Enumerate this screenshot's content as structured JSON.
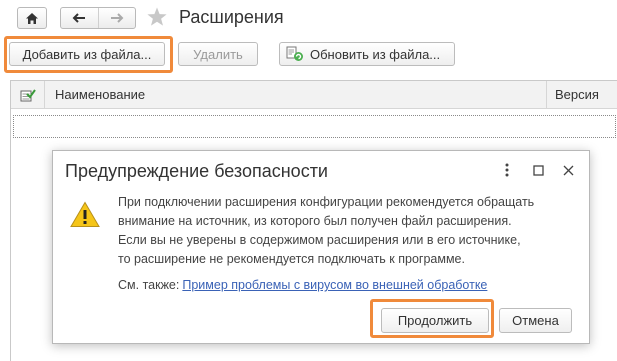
{
  "window": {
    "title": "Расширения"
  },
  "toolbar": {
    "add_label": "Добавить из файла...",
    "delete_label": "Удалить",
    "update_label": "Обновить из файла..."
  },
  "table": {
    "columns": [
      "Наименование",
      "Версия"
    ]
  },
  "dialog": {
    "title": "Предупреждение безопасности",
    "message_lines": [
      "При подключении расширения конфигурации рекомендуется обращать",
      "внимание на источник, из которого был получен файл расширения.",
      "Если вы не уверены в содержимом расширения или в его источнике,",
      "то расширение не рекомендуется подключать к программе."
    ],
    "see_also_label": "См. также:",
    "see_also_link": "Пример проблемы с вирусом во внешней обработке",
    "continue_label": "Продолжить",
    "cancel_label": "Отмена"
  },
  "colors": {
    "highlight": "#f08a3b",
    "link": "#3a62b6",
    "warning": "#f5c518"
  },
  "icons": [
    "home-icon",
    "back-arrow-icon",
    "forward-arrow-icon",
    "star-icon",
    "update-from-file-icon",
    "table-settings-icon",
    "more-icon",
    "maximize-icon",
    "close-icon",
    "warning-icon"
  ]
}
